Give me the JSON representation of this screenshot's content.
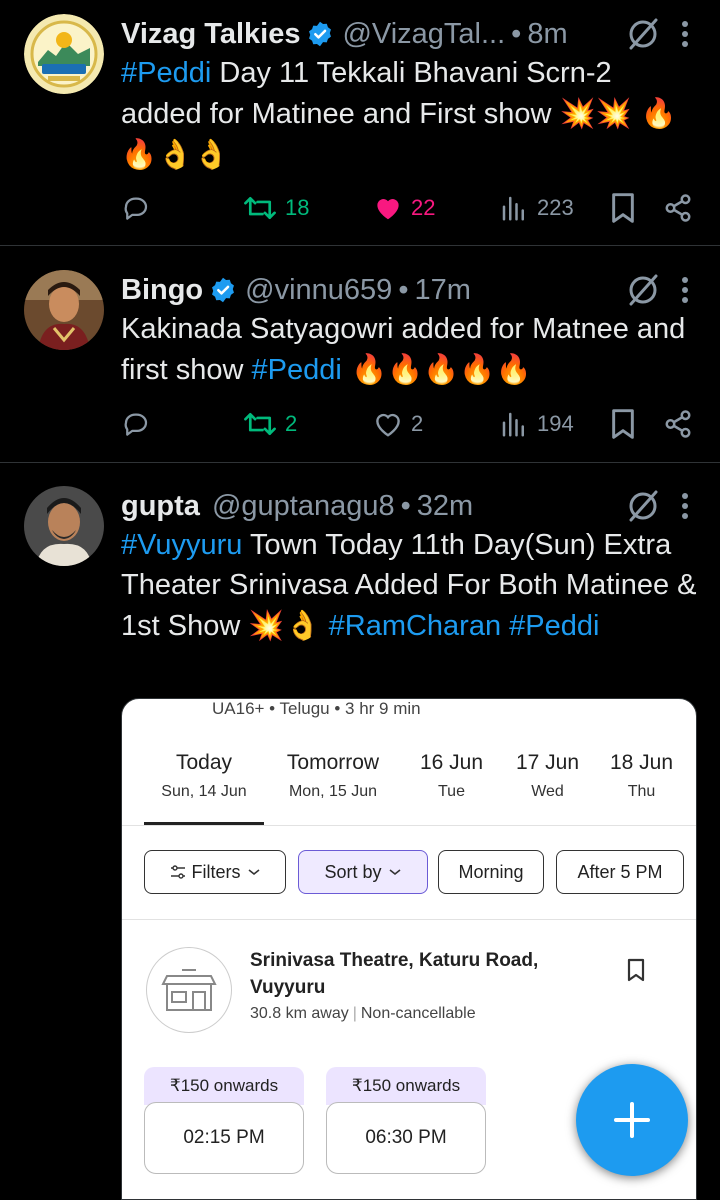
{
  "tweets": [
    {
      "name": "Vizag Talkies",
      "handle": "@VizagTal...",
      "time": "8m",
      "text": [
        {
          "t": "#Peddi",
          "tag": true
        },
        {
          "t": " Day 11 Tekkali Bhavani Scrn-2 added for Matinee and First show ",
          "tag": false
        },
        {
          "t": "💥💥 🔥🔥👌👌",
          "tag": false,
          "emoji": true
        }
      ],
      "replies": "",
      "retweets": "18",
      "likes": "22",
      "liked": true,
      "views": "223"
    },
    {
      "name": "Bingo",
      "handle": "@vinnu659",
      "time": "17m",
      "text": [
        {
          "t": "Kakinada Satyagowri added for Matnee and first show ",
          "tag": false
        },
        {
          "t": "#Peddi",
          "tag": true
        },
        {
          "t": " 🔥🔥🔥🔥🔥",
          "tag": false,
          "emoji": true
        }
      ],
      "replies": "",
      "retweets": "2",
      "likes": "2",
      "liked": false,
      "views": "194"
    },
    {
      "name": "gupta",
      "handle": "@guptanagu8",
      "time": "32m",
      "text": [
        {
          "t": "#Vuyyuru",
          "tag": true
        },
        {
          "t": " Town Today 11th Day(Sun) Extra Theater Srinivasa Added For Both Matinee & 1st Show ",
          "tag": false
        },
        {
          "t": "💥👌",
          "tag": false,
          "emoji": true
        },
        {
          "t": " ",
          "tag": false
        },
        {
          "t": "#RamCharan",
          "tag": true
        },
        {
          "t": " ",
          "tag": false
        },
        {
          "t": "#Peddi",
          "tag": true
        }
      ]
    }
  ],
  "embed": {
    "cert": "UA16+ • Telugu • 3 hr 9 min",
    "dates": [
      {
        "day": "Today",
        "date": "Sun, 14 Jun"
      },
      {
        "day": "Tomorrow",
        "date": "Mon, 15 Jun"
      },
      {
        "day": "16 Jun",
        "date": "Tue"
      },
      {
        "day": "17 Jun",
        "date": "Wed"
      },
      {
        "day": "18 Jun",
        "date": "Thu"
      }
    ],
    "filters": {
      "filters": "Filters",
      "sort": "Sort by",
      "morning": "Morning",
      "after5": "After 5 PM"
    },
    "theatre": {
      "name": "Srinivasa Theatre, Katuru Road, Vuyyuru",
      "distance": "30.8 km away",
      "policy": "Non-cancellable"
    },
    "shows": [
      {
        "price": "₹150 onwards",
        "time": "02:15 PM"
      },
      {
        "price": "₹150 onwards",
        "time": "06:30 PM"
      }
    ]
  },
  "colors": {
    "accent": "#1d9bf0",
    "retweet": "#00ba7c",
    "like": "#f91880",
    "muted": "#8b98a5"
  },
  "icons": [
    "verified-badge-icon",
    "grok-icon",
    "more-icon",
    "reply-icon",
    "retweet-icon",
    "like-icon",
    "views-icon",
    "bookmark-icon",
    "share-icon",
    "compose-icon"
  ]
}
